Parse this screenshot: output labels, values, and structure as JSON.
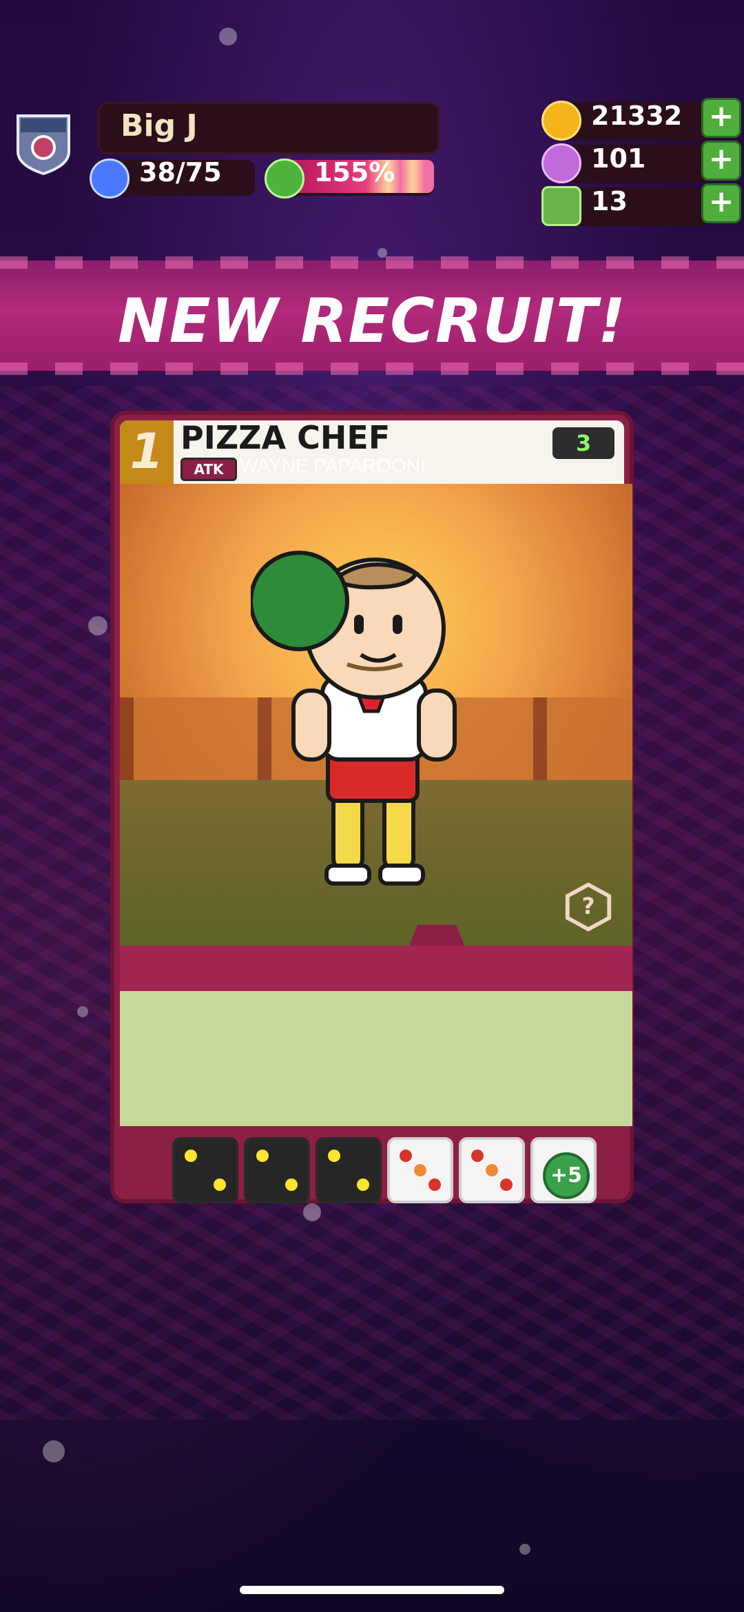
{
  "player": {
    "name": "Big J",
    "population": "38/75",
    "happiness": "155%"
  },
  "resources": {
    "coins": "21332",
    "gems": "101",
    "blocks": "13"
  },
  "banner": {
    "title": "NEW RECRUIT!"
  },
  "card": {
    "level": "1",
    "title": "PIZZA CHEF",
    "badge": "ATK",
    "character_name": "WAYNE PAPAROONI",
    "cost": "3",
    "help": "?",
    "dice": [
      {
        "type": "black",
        "face": "two"
      },
      {
        "type": "black",
        "face": "two"
      },
      {
        "type": "black",
        "face": "two"
      },
      {
        "type": "white",
        "face": "three-red"
      },
      {
        "type": "white",
        "face": "three-red"
      },
      {
        "type": "white",
        "face": "plus-five",
        "label": "+5"
      }
    ]
  },
  "colors": {
    "banner": "#b22a7c",
    "card_frame": "#8c1f45",
    "plus_button": "#4fae3c",
    "desc_area": "#c6d89a"
  }
}
